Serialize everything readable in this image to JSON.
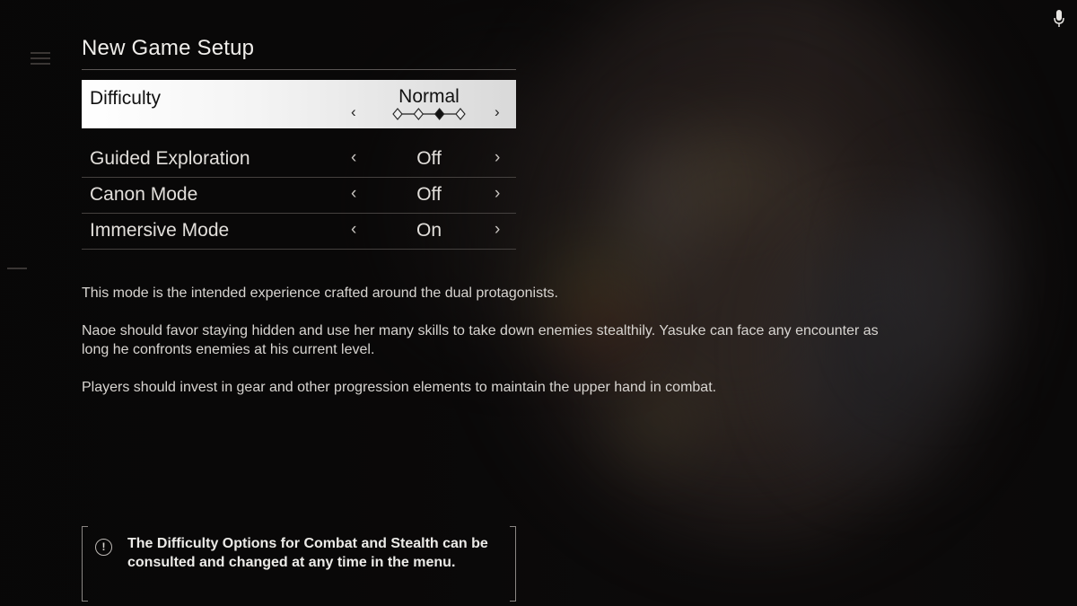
{
  "page": {
    "title": "New Game Setup"
  },
  "options": [
    {
      "label": "Difficulty",
      "value": "Normal",
      "selected": true,
      "difficulty_level": 3,
      "difficulty_levels_total": 4
    },
    {
      "label": "Guided Exploration",
      "value": "Off"
    },
    {
      "label": "Canon Mode",
      "value": "Off"
    },
    {
      "label": "Immersive Mode",
      "value": "On"
    }
  ],
  "arrows": {
    "left": "‹",
    "right": "›"
  },
  "description": [
    "This mode is the intended experience crafted around the dual protagonists.",
    "Naoe should favor staying hidden and use her many skills to take down enemies stealthily. Yasuke can face any encounter as long he confronts enemies at his current level.",
    "Players should invest in gear and other progression elements to maintain the upper hand in combat."
  ],
  "notice": {
    "icon": "exclamation-icon",
    "icon_glyph": "!",
    "text": "The Difficulty Options for Combat and Stealth can be consulted and changed at any time in the menu."
  },
  "icons": {
    "microphone": "microphone-icon"
  },
  "colors": {
    "selected_row_bg": "#ffffff",
    "text": "#e2dfdb",
    "background": "#0d0b0b"
  }
}
